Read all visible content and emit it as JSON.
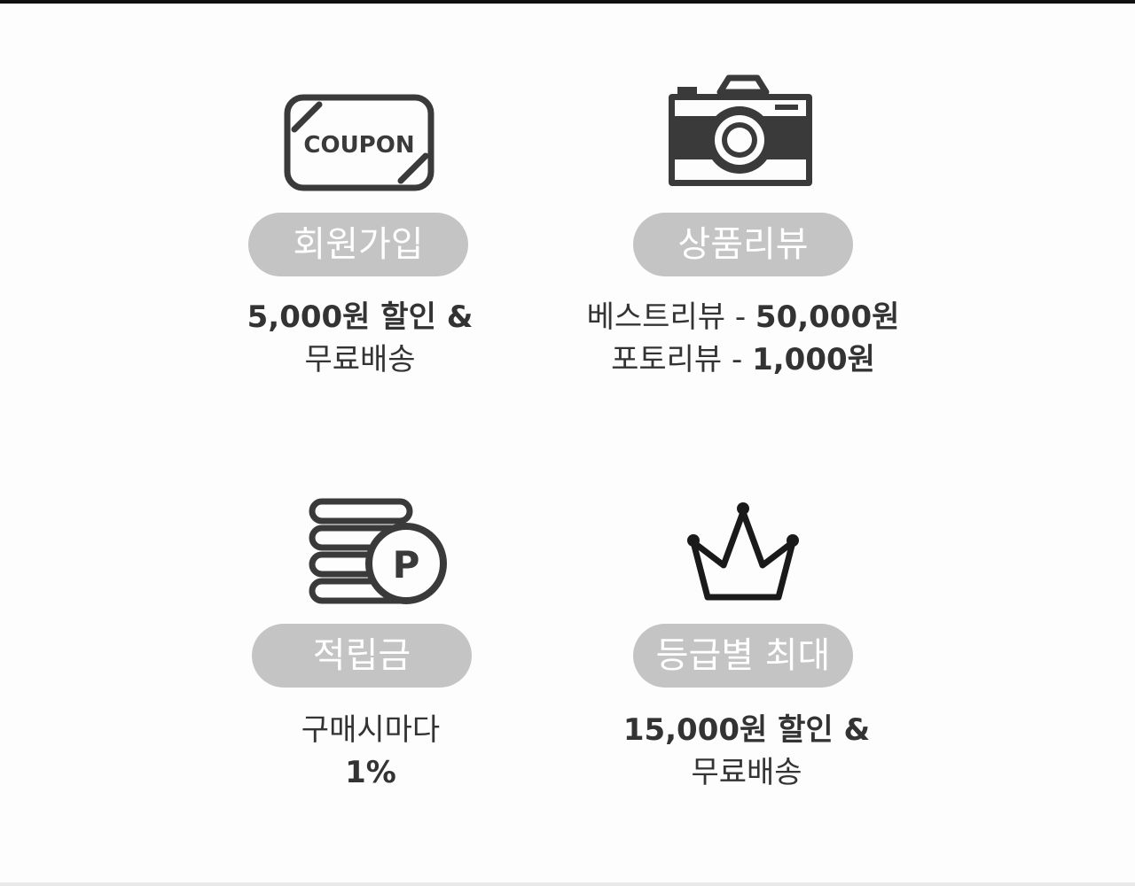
{
  "benefits": [
    {
      "icon": "coupon-icon",
      "icon_text": "COUPON",
      "title": "회원가입",
      "line1": "5,000원 할인 &",
      "line2": "무료배송"
    },
    {
      "icon": "camera-icon",
      "title": "상품리뷰",
      "line1_label": "베스트리뷰 - ",
      "line1_value": "50,000원",
      "line2_label": "포토리뷰 - ",
      "line2_value": "1,000원"
    },
    {
      "icon": "coins-point-icon",
      "icon_text": "P",
      "title": "적립금",
      "line1": "구매시마다",
      "line2": "1%"
    },
    {
      "icon": "crown-icon",
      "title": "등급별 최대",
      "line1": "15,000원 할인 &",
      "line2": "무료배송"
    }
  ],
  "colors": {
    "icon": "#3a3a3a",
    "pill_bg": "#c4c4c4",
    "pill_text": "#ffffff",
    "text": "#333333"
  }
}
